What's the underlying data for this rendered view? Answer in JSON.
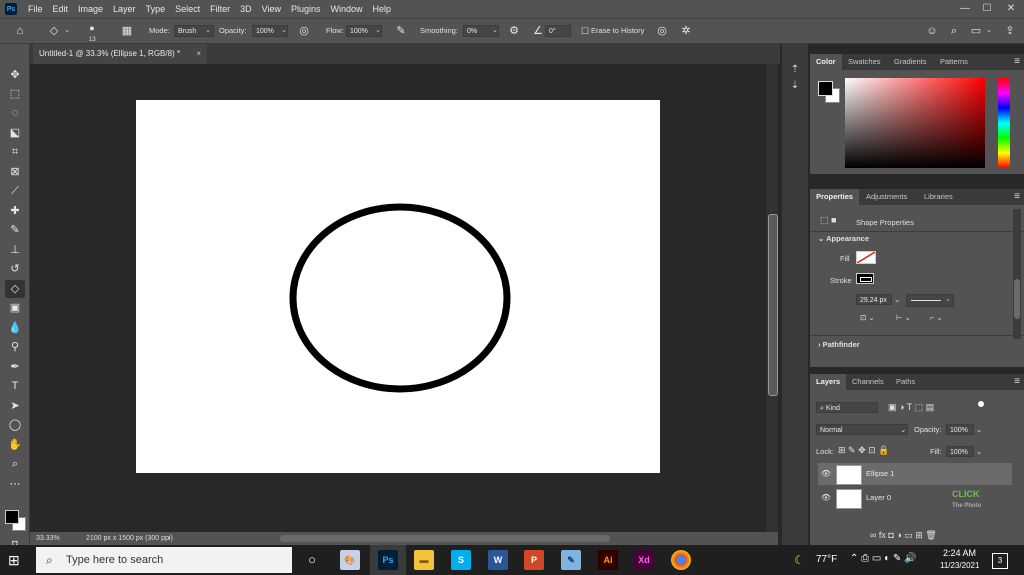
{
  "app": {
    "logo": "Ps"
  },
  "menu": [
    "File",
    "Edit",
    "Image",
    "Layer",
    "Type",
    "Select",
    "Filter",
    "3D",
    "View",
    "Plugins",
    "Window",
    "Help"
  ],
  "window_controls": {
    "minimize": "—",
    "maximize": "☐",
    "close": "✕"
  },
  "options_bar": {
    "brush_size": "13",
    "mode_label": "Mode:",
    "mode_value": "Brush",
    "opacity_label": "Opacity:",
    "opacity_value": "100%",
    "flow_label": "Flow:",
    "flow_value": "100%",
    "smoothing_label": "Smoothing:",
    "smoothing_value": "0%",
    "angle_value": "0°",
    "erase_history_label": "Erase to History"
  },
  "document": {
    "tab_title": "Untitled-1 @ 33.3% (Ellipse 1, RGB/8) *",
    "tab_close": "×",
    "zoom": "33.33%",
    "size_info": "2100 px x 1500 px (300 ppi)"
  },
  "color_panel": {
    "tabs": [
      "Color",
      "Swatches",
      "Gradients",
      "Patterns"
    ],
    "active": "Color",
    "fg": "#000000",
    "bg": "#ffffff"
  },
  "properties_panel": {
    "tabs": [
      "Properties",
      "Adjustments",
      "Libraries"
    ],
    "title": "Shape Properties",
    "appearance": "Appearance",
    "fill_label": "Fill",
    "stroke_label": "Stroke",
    "stroke_width": "29.24 px",
    "pathfinder": "Pathfinder"
  },
  "layers_panel": {
    "tabs": [
      "Layers",
      "Channels",
      "Paths"
    ],
    "filter_kind": "Kind",
    "blend_mode": "Normal",
    "opacity_label": "Opacity:",
    "opacity_value": "100%",
    "lock_label": "Lock:",
    "fill_label": "Fill:",
    "fill_value": "100%",
    "layers": [
      {
        "name": "Ellipse 1",
        "selected": true
      },
      {
        "name": "Layer 0",
        "selected": false
      }
    ]
  },
  "taskbar": {
    "search_placeholder": "Type here to search",
    "apps": [
      "Ps",
      "S",
      "W",
      "P",
      "Ai",
      "Xd"
    ],
    "weather": "77°F",
    "time": "2:24 AM",
    "date": "11/23/2021",
    "notif_count": "3"
  },
  "watermark": {
    "line1": "CLICK",
    "line2": "The Photo"
  }
}
